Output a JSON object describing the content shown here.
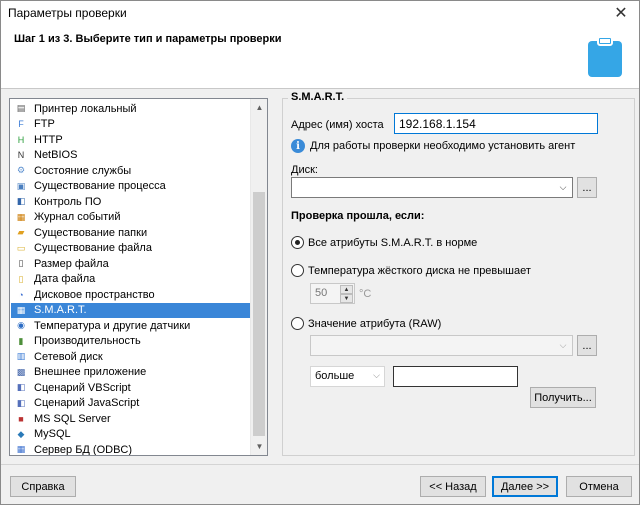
{
  "window": {
    "title": "Параметры проверки"
  },
  "header": {
    "step_title": "Шаг 1 из 3. Выберите тип и параметры проверки",
    "icon": "clipboard-icon"
  },
  "list": {
    "items": [
      {
        "label": "Принтер локальный",
        "icon": "printer-icon"
      },
      {
        "label": "FTP",
        "icon": "ftp-icon"
      },
      {
        "label": "HTTP",
        "icon": "http-icon"
      },
      {
        "label": "NetBIOS",
        "icon": "netbios-icon"
      },
      {
        "label": "Состояние службы",
        "icon": "service-icon"
      },
      {
        "label": "Существование процесса",
        "icon": "process-icon"
      },
      {
        "label": "Контроль ПО",
        "icon": "software-icon"
      },
      {
        "label": "Журнал событий",
        "icon": "eventlog-icon"
      },
      {
        "label": "Существование папки",
        "icon": "folder-icon"
      },
      {
        "label": "Существование файла",
        "icon": "file-icon"
      },
      {
        "label": "Размер файла",
        "icon": "filesize-icon"
      },
      {
        "label": "Дата файла",
        "icon": "filedate-icon"
      },
      {
        "label": "Дисковое пространство",
        "icon": "disk-icon"
      },
      {
        "label": "S.M.A.R.T.",
        "icon": "smart-icon",
        "selected": true
      },
      {
        "label": "Температура и другие датчики",
        "icon": "sensor-icon"
      },
      {
        "label": "Производительность",
        "icon": "performance-icon"
      },
      {
        "label": "Сетевой диск",
        "icon": "netdrive-icon"
      },
      {
        "label": "Внешнее приложение",
        "icon": "app-icon"
      },
      {
        "label": "Сценарий VBScript",
        "icon": "vbscript-icon"
      },
      {
        "label": "Сценарий JavaScript",
        "icon": "javascript-icon"
      },
      {
        "label": "MS SQL Server",
        "icon": "mssql-icon"
      },
      {
        "label": "MySQL",
        "icon": "mysql-icon"
      },
      {
        "label": "Сервер БД (ODBC)",
        "icon": "odbc-icon"
      }
    ]
  },
  "panel": {
    "title": "S.M.A.R.T.",
    "host_label": "Адрес (имя) хоста",
    "host_value": "192.168.1.154",
    "agent_note": "Для работы проверки необходимо установить агент",
    "disk_label": "Диск:",
    "disk_value": "",
    "browse_label": "...",
    "condition_title": "Проверка прошла, если:",
    "options": {
      "all_ok": "Все атрибуты S.M.A.R.T. в норме",
      "temperature": "Температура жёсткого диска не превышает",
      "raw_value": "Значение атрибута (RAW)"
    },
    "temp_value": "50",
    "temp_unit": "°C",
    "compare_value": "больше",
    "raw_input": "",
    "fetch_label": "Получить..."
  },
  "footer": {
    "help": "Справка",
    "back": "<< Назад",
    "next": "Далее >>",
    "cancel": "Отмена"
  }
}
